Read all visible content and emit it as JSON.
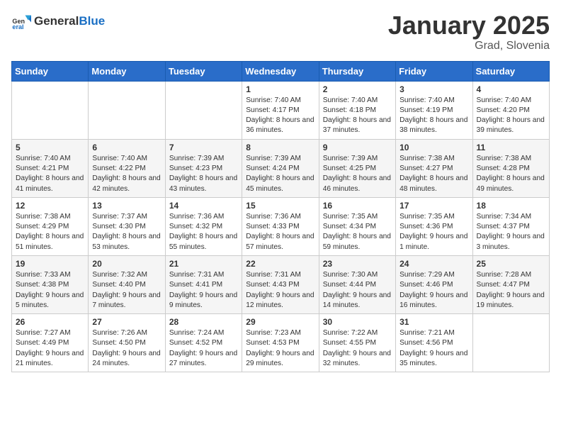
{
  "header": {
    "logo_general": "General",
    "logo_blue": "Blue",
    "month": "January 2025",
    "location": "Grad, Slovenia"
  },
  "days_of_week": [
    "Sunday",
    "Monday",
    "Tuesday",
    "Wednesday",
    "Thursday",
    "Friday",
    "Saturday"
  ],
  "weeks": [
    [
      {
        "day": "",
        "content": ""
      },
      {
        "day": "",
        "content": ""
      },
      {
        "day": "",
        "content": ""
      },
      {
        "day": "1",
        "content": "Sunrise: 7:40 AM\nSunset: 4:17 PM\nDaylight: 8 hours and 36 minutes."
      },
      {
        "day": "2",
        "content": "Sunrise: 7:40 AM\nSunset: 4:18 PM\nDaylight: 8 hours and 37 minutes."
      },
      {
        "day": "3",
        "content": "Sunrise: 7:40 AM\nSunset: 4:19 PM\nDaylight: 8 hours and 38 minutes."
      },
      {
        "day": "4",
        "content": "Sunrise: 7:40 AM\nSunset: 4:20 PM\nDaylight: 8 hours and 39 minutes."
      }
    ],
    [
      {
        "day": "5",
        "content": "Sunrise: 7:40 AM\nSunset: 4:21 PM\nDaylight: 8 hours and 41 minutes."
      },
      {
        "day": "6",
        "content": "Sunrise: 7:40 AM\nSunset: 4:22 PM\nDaylight: 8 hours and 42 minutes."
      },
      {
        "day": "7",
        "content": "Sunrise: 7:39 AM\nSunset: 4:23 PM\nDaylight: 8 hours and 43 minutes."
      },
      {
        "day": "8",
        "content": "Sunrise: 7:39 AM\nSunset: 4:24 PM\nDaylight: 8 hours and 45 minutes."
      },
      {
        "day": "9",
        "content": "Sunrise: 7:39 AM\nSunset: 4:25 PM\nDaylight: 8 hours and 46 minutes."
      },
      {
        "day": "10",
        "content": "Sunrise: 7:38 AM\nSunset: 4:27 PM\nDaylight: 8 hours and 48 minutes."
      },
      {
        "day": "11",
        "content": "Sunrise: 7:38 AM\nSunset: 4:28 PM\nDaylight: 8 hours and 49 minutes."
      }
    ],
    [
      {
        "day": "12",
        "content": "Sunrise: 7:38 AM\nSunset: 4:29 PM\nDaylight: 8 hours and 51 minutes."
      },
      {
        "day": "13",
        "content": "Sunrise: 7:37 AM\nSunset: 4:30 PM\nDaylight: 8 hours and 53 minutes."
      },
      {
        "day": "14",
        "content": "Sunrise: 7:36 AM\nSunset: 4:32 PM\nDaylight: 8 hours and 55 minutes."
      },
      {
        "day": "15",
        "content": "Sunrise: 7:36 AM\nSunset: 4:33 PM\nDaylight: 8 hours and 57 minutes."
      },
      {
        "day": "16",
        "content": "Sunrise: 7:35 AM\nSunset: 4:34 PM\nDaylight: 8 hours and 59 minutes."
      },
      {
        "day": "17",
        "content": "Sunrise: 7:35 AM\nSunset: 4:36 PM\nDaylight: 9 hours and 1 minute."
      },
      {
        "day": "18",
        "content": "Sunrise: 7:34 AM\nSunset: 4:37 PM\nDaylight: 9 hours and 3 minutes."
      }
    ],
    [
      {
        "day": "19",
        "content": "Sunrise: 7:33 AM\nSunset: 4:38 PM\nDaylight: 9 hours and 5 minutes."
      },
      {
        "day": "20",
        "content": "Sunrise: 7:32 AM\nSunset: 4:40 PM\nDaylight: 9 hours and 7 minutes."
      },
      {
        "day": "21",
        "content": "Sunrise: 7:31 AM\nSunset: 4:41 PM\nDaylight: 9 hours and 9 minutes."
      },
      {
        "day": "22",
        "content": "Sunrise: 7:31 AM\nSunset: 4:43 PM\nDaylight: 9 hours and 12 minutes."
      },
      {
        "day": "23",
        "content": "Sunrise: 7:30 AM\nSunset: 4:44 PM\nDaylight: 9 hours and 14 minutes."
      },
      {
        "day": "24",
        "content": "Sunrise: 7:29 AM\nSunset: 4:46 PM\nDaylight: 9 hours and 16 minutes."
      },
      {
        "day": "25",
        "content": "Sunrise: 7:28 AM\nSunset: 4:47 PM\nDaylight: 9 hours and 19 minutes."
      }
    ],
    [
      {
        "day": "26",
        "content": "Sunrise: 7:27 AM\nSunset: 4:49 PM\nDaylight: 9 hours and 21 minutes."
      },
      {
        "day": "27",
        "content": "Sunrise: 7:26 AM\nSunset: 4:50 PM\nDaylight: 9 hours and 24 minutes."
      },
      {
        "day": "28",
        "content": "Sunrise: 7:24 AM\nSunset: 4:52 PM\nDaylight: 9 hours and 27 minutes."
      },
      {
        "day": "29",
        "content": "Sunrise: 7:23 AM\nSunset: 4:53 PM\nDaylight: 9 hours and 29 minutes."
      },
      {
        "day": "30",
        "content": "Sunrise: 7:22 AM\nSunset: 4:55 PM\nDaylight: 9 hours and 32 minutes."
      },
      {
        "day": "31",
        "content": "Sunrise: 7:21 AM\nSunset: 4:56 PM\nDaylight: 9 hours and 35 minutes."
      },
      {
        "day": "",
        "content": ""
      }
    ]
  ]
}
